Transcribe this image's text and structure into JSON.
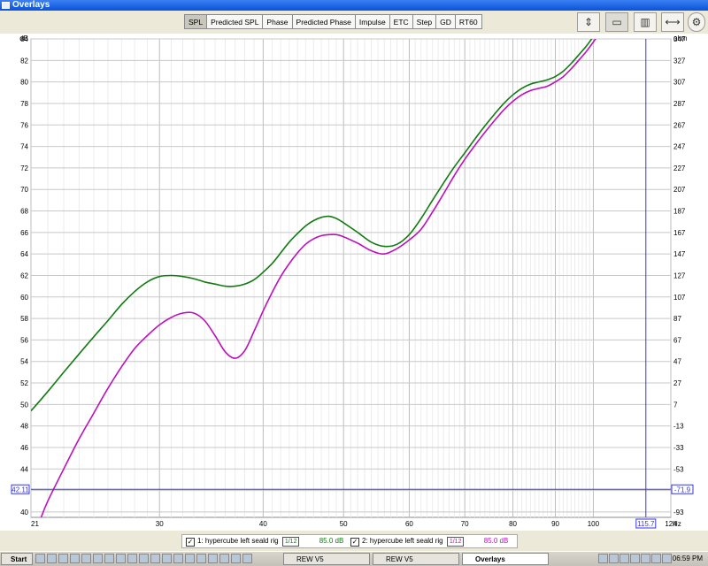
{
  "window": {
    "title": "Overlays"
  },
  "toolbar": {
    "tabs": [
      "SPL",
      "Predicted SPL",
      "Phase",
      "Predicted Phase",
      "Impulse",
      "ETC",
      "Step",
      "GD",
      "RT60"
    ],
    "active_tab": "SPL",
    "icons": [
      "vertical-resize-icon",
      "graph-settings-icon",
      "columns-icon",
      "horizontal-resize-icon",
      "gear-icon"
    ]
  },
  "chart_data": {
    "type": "line",
    "title": "",
    "ylabel": "dB",
    "y2label": "ohm",
    "xlabel": "Hz",
    "xscale": "log",
    "xlim": [
      21,
      124
    ],
    "ylim": [
      39.5,
      84
    ],
    "x_ticks": [
      21,
      30,
      40,
      50,
      60,
      70,
      80,
      90,
      100,
      124
    ],
    "y_ticks": [
      40,
      42,
      44,
      46,
      48,
      50,
      52,
      54,
      56,
      58,
      60,
      62,
      64,
      66,
      68,
      70,
      72,
      74,
      76,
      78,
      80,
      82,
      84
    ],
    "y2_ticks": [
      -93,
      -73,
      -53,
      -33,
      -13,
      7,
      27,
      47,
      67,
      87,
      107,
      127,
      147,
      167,
      187,
      207,
      227,
      247,
      267,
      287,
      307,
      327,
      347
    ],
    "grid": true,
    "cursor": {
      "x": 115.7,
      "y": 42.11,
      "y2": -71.9
    },
    "series": [
      {
        "name": "1: hypercube left seald rig",
        "color": "#117a11",
        "points": [
          [
            21,
            49.4
          ],
          [
            22,
            51.2
          ],
          [
            23,
            53
          ],
          [
            24,
            54.7
          ],
          [
            25,
            56.3
          ],
          [
            26,
            57.8
          ],
          [
            27,
            59.3
          ],
          [
            28,
            60.5
          ],
          [
            29,
            61.4
          ],
          [
            30,
            61.9
          ],
          [
            31,
            62.0
          ],
          [
            32,
            61.9
          ],
          [
            33,
            61.7
          ],
          [
            34,
            61.4
          ],
          [
            35,
            61.2
          ],
          [
            36,
            61.0
          ],
          [
            37,
            61.0
          ],
          [
            38,
            61.2
          ],
          [
            39,
            61.6
          ],
          [
            40,
            62.3
          ],
          [
            41,
            63.1
          ],
          [
            42,
            64.1
          ],
          [
            43,
            65.1
          ],
          [
            44,
            65.9
          ],
          [
            45,
            66.6
          ],
          [
            46,
            67.1
          ],
          [
            47,
            67.4
          ],
          [
            48,
            67.5
          ],
          [
            49,
            67.3
          ],
          [
            50,
            66.9
          ],
          [
            52,
            66.0
          ],
          [
            54,
            65.1
          ],
          [
            56,
            64.7
          ],
          [
            58,
            64.9
          ],
          [
            60,
            65.8
          ],
          [
            62,
            67.3
          ],
          [
            64,
            69.0
          ],
          [
            66,
            70.6
          ],
          [
            68,
            72.1
          ],
          [
            70,
            73.4
          ],
          [
            72,
            74.7
          ],
          [
            74,
            75.9
          ],
          [
            76,
            77.0
          ],
          [
            78,
            78.0
          ],
          [
            80,
            78.8
          ],
          [
            82,
            79.4
          ],
          [
            84,
            79.8
          ],
          [
            86,
            80.0
          ],
          [
            88,
            80.2
          ],
          [
            90,
            80.5
          ],
          [
            92,
            81.0
          ],
          [
            94,
            81.7
          ],
          [
            96,
            82.5
          ],
          [
            98,
            83.3
          ],
          [
            100,
            84.2
          ]
        ]
      },
      {
        "name": "2: hypercube left seald rig",
        "color": "#bb11bb",
        "points": [
          [
            21.6,
            39.5
          ],
          [
            22,
            41
          ],
          [
            23,
            44
          ],
          [
            24,
            46.8
          ],
          [
            25,
            49.2
          ],
          [
            26,
            51.5
          ],
          [
            27,
            53.5
          ],
          [
            28,
            55.2
          ],
          [
            29,
            56.4
          ],
          [
            30,
            57.4
          ],
          [
            31,
            58.1
          ],
          [
            32,
            58.5
          ],
          [
            33,
            58.5
          ],
          [
            34,
            57.8
          ],
          [
            35,
            56.4
          ],
          [
            36,
            54.9
          ],
          [
            37,
            54.3
          ],
          [
            38,
            55.0
          ],
          [
            39,
            56.8
          ],
          [
            40,
            58.7
          ],
          [
            41,
            60.4
          ],
          [
            42,
            61.9
          ],
          [
            43,
            63.1
          ],
          [
            44,
            64.1
          ],
          [
            45,
            64.9
          ],
          [
            46,
            65.4
          ],
          [
            47,
            65.7
          ],
          [
            48,
            65.8
          ],
          [
            49,
            65.8
          ],
          [
            50,
            65.6
          ],
          [
            52,
            65.0
          ],
          [
            54,
            64.3
          ],
          [
            56,
            64.0
          ],
          [
            58,
            64.5
          ],
          [
            60,
            65.3
          ],
          [
            62,
            66.3
          ],
          [
            64,
            67.9
          ],
          [
            66,
            69.6
          ],
          [
            68,
            71.3
          ],
          [
            70,
            72.8
          ],
          [
            72,
            74.1
          ],
          [
            74,
            75.3
          ],
          [
            76,
            76.4
          ],
          [
            78,
            77.4
          ],
          [
            80,
            78.2
          ],
          [
            82,
            78.8
          ],
          [
            84,
            79.2
          ],
          [
            86,
            79.4
          ],
          [
            88,
            79.6
          ],
          [
            90,
            80.0
          ],
          [
            92,
            80.5
          ],
          [
            94,
            81.2
          ],
          [
            96,
            82.0
          ],
          [
            98,
            82.8
          ],
          [
            100,
            83.7
          ],
          [
            101,
            84.2
          ]
        ]
      }
    ]
  },
  "legend": {
    "items": [
      {
        "label": "1: hypercube left seald rig",
        "smoothing": "1/12",
        "level": "85.0 dB",
        "color": "#117a11"
      },
      {
        "label": "2: hypercube left seald rig",
        "smoothing": "1/12",
        "level": "85.0 dB",
        "color": "#bb11bb"
      }
    ]
  },
  "taskbar": {
    "start": "Start",
    "tasks": [
      "REW V5",
      "REW V5",
      "Overlays"
    ],
    "clock": "06:59 PM"
  }
}
